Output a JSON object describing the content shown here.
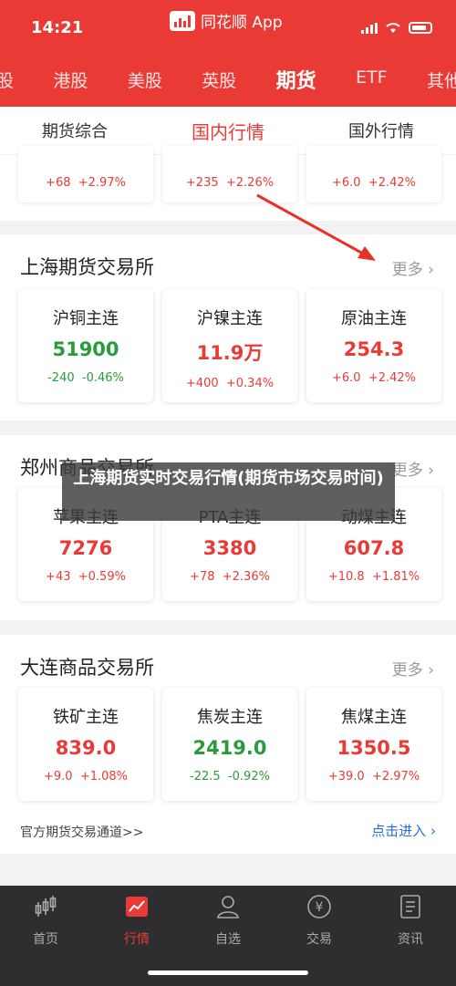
{
  "status": {
    "time": "14:21",
    "app_name": "同花顺 App"
  },
  "market_tabs": [
    "股",
    "港股",
    "美股",
    "英股",
    "期货",
    "ETF",
    "其他"
  ],
  "sub_tabs": [
    "期货综合",
    "国内行情",
    "国外行情"
  ],
  "top_strip": [
    {
      "chg": "+68",
      "pct": "+2.97%"
    },
    {
      "chg": "+235",
      "pct": "+2.26%"
    },
    {
      "chg": "+6.0",
      "pct": "+2.42%"
    }
  ],
  "sections": [
    {
      "title": "上海期货交易所",
      "more": "更多",
      "items": [
        {
          "name": "沪铜主连",
          "price": "51900",
          "chg": "-240",
          "pct": "-0.46%",
          "dir": "down"
        },
        {
          "name": "沪镍主连",
          "price": "11.9万",
          "chg": "+400",
          "pct": "+0.34%",
          "dir": "up"
        },
        {
          "name": "原油主连",
          "price": "254.3",
          "chg": "+6.0",
          "pct": "+2.42%",
          "dir": "up"
        }
      ]
    },
    {
      "title": "郑州商品交易所",
      "more": "更多",
      "items": [
        {
          "name": "苹果主连",
          "price": "7276",
          "chg": "+43",
          "pct": "+0.59%",
          "dir": "up"
        },
        {
          "name": "PTA主连",
          "price": "3380",
          "chg": "+78",
          "pct": "+2.36%",
          "dir": "up"
        },
        {
          "name": "动煤主连",
          "price": "607.8",
          "chg": "+10.8",
          "pct": "+1.81%",
          "dir": "up"
        }
      ]
    },
    {
      "title": "大连商品交易所",
      "more": "更多",
      "items": [
        {
          "name": "铁矿主连",
          "price": "839.0",
          "chg": "+9.0",
          "pct": "+1.08%",
          "dir": "up"
        },
        {
          "name": "焦炭主连",
          "price": "2419.0",
          "chg": "-22.5",
          "pct": "-0.92%",
          "dir": "down"
        },
        {
          "name": "焦煤主连",
          "price": "1350.5",
          "chg": "+39.0",
          "pct": "+2.97%",
          "dir": "up"
        }
      ]
    }
  ],
  "footer": {
    "link": "官方期货交易通道>>",
    "action": "点击进入"
  },
  "overlay_text": "上海期货实时交易行情(期货市场交易时间)",
  "tabbar": [
    {
      "label": "首页",
      "icon": "candlestick-icon"
    },
    {
      "label": "行情",
      "icon": "chart-icon"
    },
    {
      "label": "自选",
      "icon": "user-icon"
    },
    {
      "label": "交易",
      "icon": "yen-icon"
    },
    {
      "label": "资讯",
      "icon": "news-icon"
    }
  ],
  "colors": {
    "brand": "#e93a36",
    "down": "#2a9b3a",
    "link": "#2a6fd6"
  }
}
